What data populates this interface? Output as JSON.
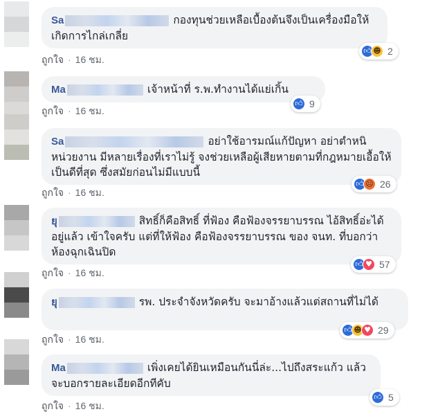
{
  "comments": [
    {
      "author": "Sa",
      "text": "กองทุนช่วยเหลือเบื้องต้นจึงเป็นเครื่องมือให้เกิดการไกล่เกลี่ย",
      "reactions": [
        "like-icon",
        "haha-icon"
      ],
      "reaction_count": "2",
      "like_label": "ถูกใจ",
      "time": "16 ชม."
    },
    {
      "author": "Ma",
      "text": "เจ้าหน้าที่ ร.พ.ทำงานได้แย่เกิ้น",
      "reactions": [
        "like-icon"
      ],
      "reaction_count": "9",
      "like_label": "ถูกใจ",
      "time": "16 ชม."
    },
    {
      "author": "Sa",
      "text": "อย่าใช้อารมณ์แก้ปัญหา อย่าตำหนิหน่วยงาน มีหลายเรื่องที่เราไม่รู้ จงช่วยเหลือผู้เสียหายตามที่กฎหมายเอื้อให้เป็นดีที่สุด ซึ่งสมัยก่อนไม่มีแบบนี้",
      "reactions": [
        "like-icon",
        "angry-icon"
      ],
      "reaction_count": "26",
      "like_label": "ถูกใจ",
      "time": "16 ชม."
    },
    {
      "author": "ยุ",
      "text": "สิทธิ์ก็คือสิทธิ์ ที่ฟ้อง คือฟ้องจรรยาบรรณ ไอ้สิทธิ์อ่ะได้อยู่แล้ว เข้าใจครับ แต่ที่ให้ฟ้อง คือฟ้องจรรยาบรรณ ของ จนท. ที่บอกว่าห้องฉุกเฉินปิด",
      "reactions": [
        "like-icon",
        "love-icon"
      ],
      "reaction_count": "57",
      "like_label": "ถูกใจ",
      "time": "16 ชม."
    },
    {
      "author": "ยุ",
      "text": "รพ. ประจำจังหวัดครับ จะมาอ้างแล้วแต่สถานที่ไม่ได้",
      "reactions": [
        "like-icon",
        "haha-icon",
        "love-icon"
      ],
      "reaction_count": "29",
      "like_label": "ถูกใจ",
      "time": "16 ชม."
    },
    {
      "author": "Ma",
      "text": "เพิ่งเคยได้ยินเหมือนกันนี่ล่ะ...ไปถึงสระแก้ว แล้วจะบอกรายละเอียดอีกทีคับ",
      "reactions": [
        "like-icon"
      ],
      "reaction_count": "5",
      "like_label": "ถูกใจ",
      "time": "16 ชม."
    }
  ],
  "colors": {
    "author": "#385898",
    "bubble": "#f2f3f5",
    "like": "#2e6bd8",
    "meta": "#616770"
  }
}
